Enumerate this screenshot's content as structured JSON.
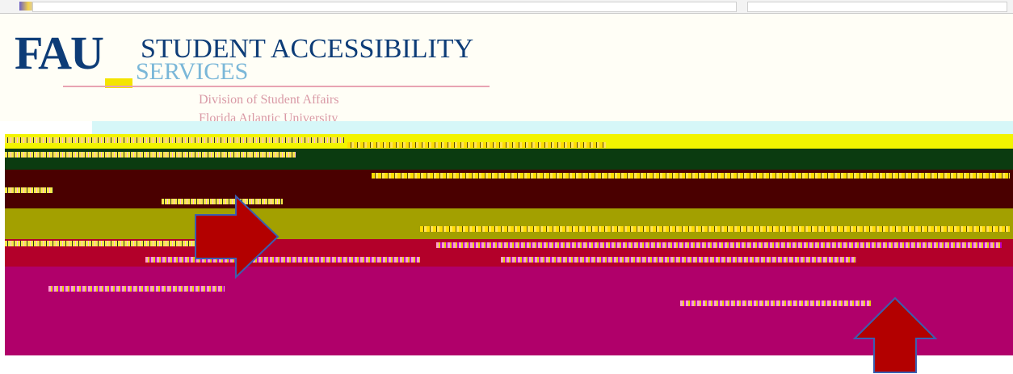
{
  "header": {
    "logo_text": "FAU",
    "title_line1": "STUDENT ACCESSIBILITY",
    "title_line2": "SERVICES",
    "subtitle_line1": "Division of Student Affairs",
    "subtitle_line2": "Florida Atlantic University"
  },
  "colors": {
    "brand_blue": "#0d3c77",
    "band_magenta": "#b0006a",
    "band_red": "#b3002a",
    "arrow_fill": "#b30000",
    "arrow_outline": "#3a5fb0"
  },
  "annotations": {
    "right_arrow": "arrow-right",
    "up_arrow": "arrow-up"
  }
}
